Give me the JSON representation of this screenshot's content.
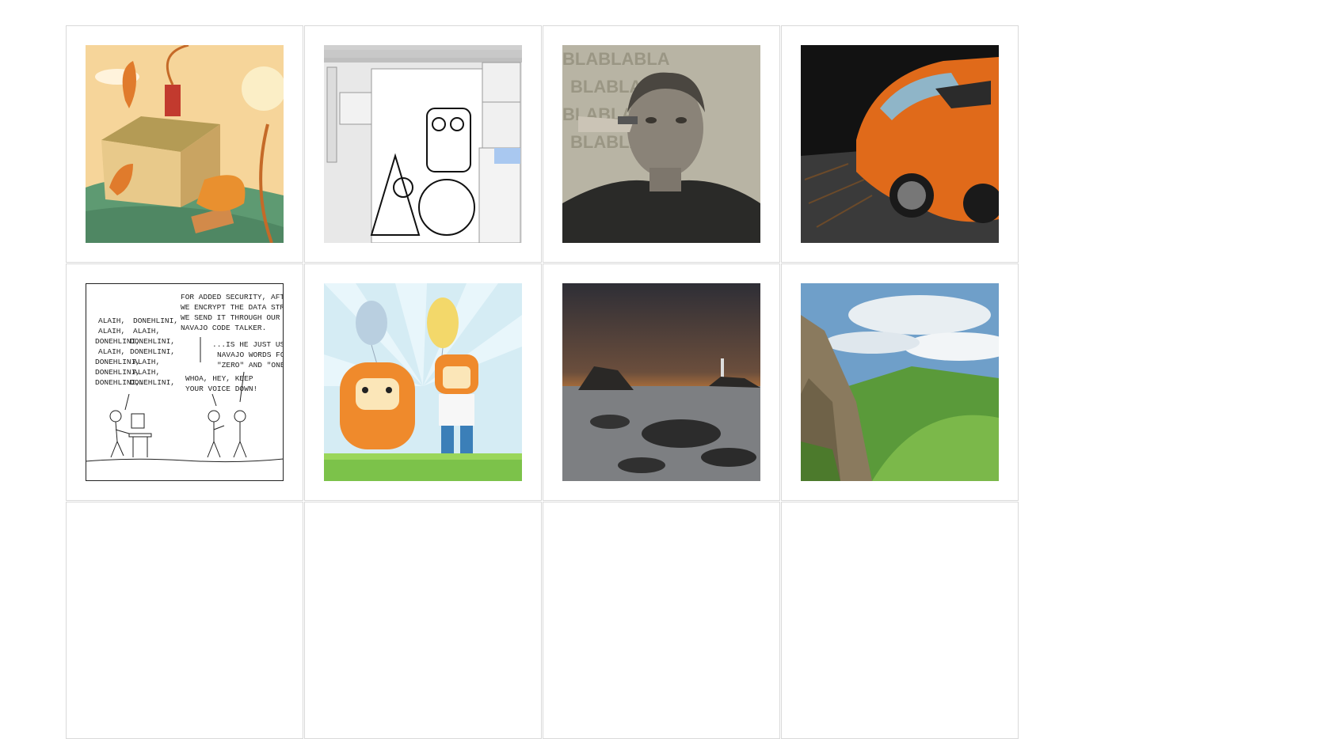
{
  "gallery": {
    "thumbnails": [
      {
        "subject": "cartoon-house-illustration"
      },
      {
        "subject": "illustrator-screenshot-drawing"
      },
      {
        "subject": "man-face-painted-portrait"
      },
      {
        "subject": "orange-sports-car"
      },
      {
        "subject": "xkcd-comic"
      },
      {
        "subject": "cartoon-monsters-balloons"
      },
      {
        "subject": "seascape-lighthouse-sunset"
      },
      {
        "subject": "green-mountain-valley"
      }
    ],
    "comic": {
      "left_col": [
        "ALAIH,",
        "ALAIH,",
        "DONEHLINI,",
        "ALAIH,",
        "DONEHLINI,",
        "DONEHLINI,",
        "DONEHLINI,"
      ],
      "right_col": [
        "DONEHLINI,",
        "ALAIH,",
        "DONEHLINI,",
        "DONEHLINI,",
        "ALAIH,",
        "ALAIH,",
        "DONEHLINI,"
      ],
      "ellipsis": "...",
      "caption_line1": "FOR ADDED SECURITY, AFTER",
      "caption_line2": "WE ENCRYPT THE DATA STREAM,",
      "caption_line3": "WE SEND IT THROUGH OUR",
      "caption_line4": "NAVAJO CODE TALKER.",
      "reply_line1": "...IS HE JUST USING",
      "reply_line2": "NAVAJO WORDS FOR",
      "reply_line3": "\"ZERO\" AND \"ONE\"?",
      "whoa_line1": "WHOA, HEY, KEEP",
      "whoa_line2": "YOUR VOICE DOWN!"
    },
    "face_watermark": "BLABLABLA"
  }
}
